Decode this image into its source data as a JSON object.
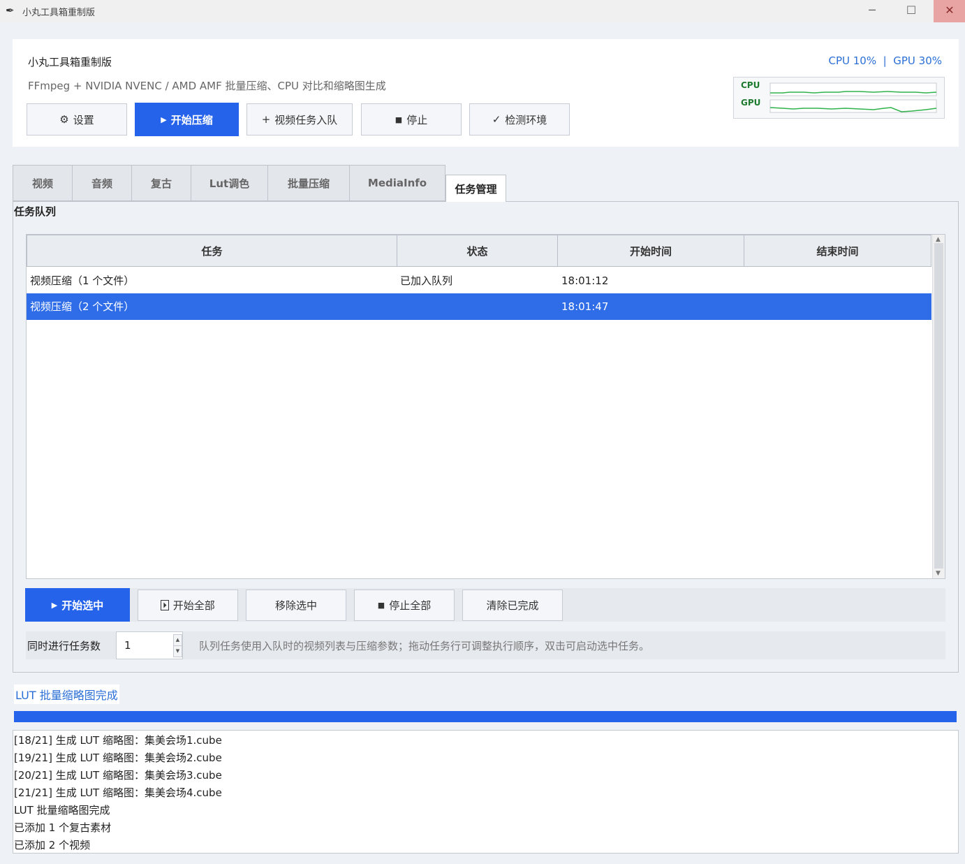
{
  "window": {
    "title": "小丸工具箱重制版",
    "icon": "feather-icon",
    "minimize": "─",
    "maximize": "☐",
    "close": "✕"
  },
  "header": {
    "app_name": "小丸工具箱重制版",
    "subtitle": "FFmpeg + NVIDIA NVENC / AMD AMF 批量压缩、CPU 对比和缩略图生成",
    "usage_text": "CPU 10%  |  GPU 30%",
    "graph": {
      "cpu_label": "CPU",
      "gpu_label": "GPU"
    },
    "buttons": {
      "settings": {
        "icon": "⚙",
        "label": "设置"
      },
      "start": {
        "icon": "▶",
        "label": "开始压缩"
      },
      "enqueue": {
        "icon": "+",
        "label": "视频任务入队"
      },
      "stop": {
        "icon": "■",
        "label": "停止"
      },
      "check": {
        "icon": "✓",
        "label": "检测环境"
      }
    }
  },
  "tabs": [
    "视频",
    "音频",
    "复古",
    "Lut调色",
    "批量压缩",
    "MediaInfo",
    "任务管理"
  ],
  "active_tab": "任务管理",
  "task_panel": {
    "title": "任务队列",
    "columns": [
      "任务",
      "状态",
      "开始时间",
      "结束时间"
    ],
    "rows": [
      {
        "task": "视频压缩（1 个文件）",
        "status": "已加入队列",
        "start": "18:01:12",
        "end": ""
      },
      {
        "task": "视频压缩（2 个文件）",
        "status": "",
        "start": "18:01:47",
        "end": ""
      }
    ],
    "selected_row": 1,
    "actions": {
      "start_selected": {
        "icon": "▶",
        "label": "开始选中"
      },
      "start_all": {
        "icon": "⏵",
        "label": "开始全部"
      },
      "remove_selected": {
        "label": "移除选中"
      },
      "stop_all": {
        "icon": "■",
        "label": "停止全部"
      },
      "clear_done": {
        "label": "清除已完成"
      }
    },
    "concurrency": {
      "label": "同时进行任务数",
      "value": "1",
      "hint": "队列任务使用入队时的视频列表与压缩参数；拖动任务行可调整执行顺序，双击可启动选中任务。"
    }
  },
  "status": {
    "text": "LUT 批量缩略图完成",
    "progress": 1.0
  },
  "log": [
    "[18/21] 生成 LUT 缩略图：集美会场1.cube",
    "[19/21] 生成 LUT 缩略图：集美会场2.cube",
    "[20/21] 生成 LUT 缩略图：集美会场3.cube",
    "[21/21] 生成 LUT 缩略图：集美会场4.cube",
    "LUT 批量缩略图完成",
    "已添加 1 个复古素材",
    "已添加 2 个视频"
  ],
  "colors": {
    "accent": "#2563eb",
    "selection": "#2f6de8",
    "usage_text": "#2b6fd6",
    "graph_line": "#2fb24a"
  }
}
